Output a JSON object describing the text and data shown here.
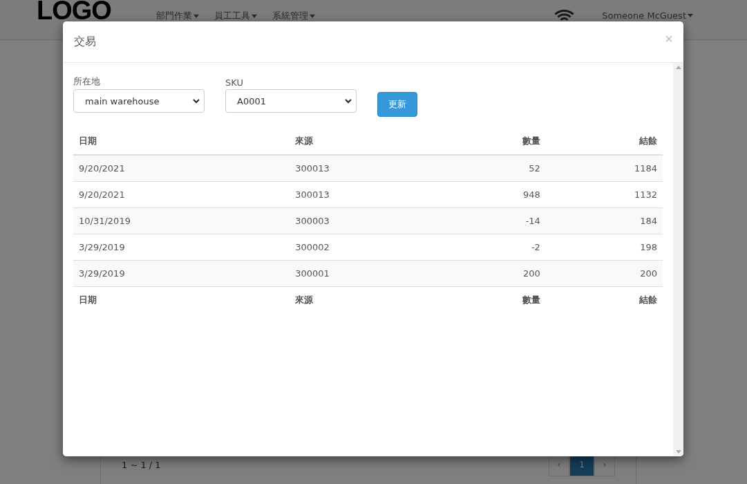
{
  "navbar": {
    "logo": "LOGO",
    "menus": [
      {
        "label": "部門作業"
      },
      {
        "label": "員工工具"
      },
      {
        "label": "系統管理"
      }
    ],
    "user": "Someone McGuest"
  },
  "background_page": {
    "pager_info": "1 ~ 1 / 1",
    "pagination": [
      {
        "label": "‹",
        "selected": false
      },
      {
        "label": "1",
        "selected": true
      },
      {
        "label": "›",
        "selected": false
      }
    ]
  },
  "modal": {
    "title": "交易",
    "close": "×",
    "filters": [
      {
        "label": "所在地",
        "value": "main warehouse"
      },
      {
        "label": "SKU",
        "value": "A0001"
      }
    ],
    "update_button": "更新",
    "table": {
      "columns": [
        {
          "label": "日期"
        },
        {
          "label": "來源"
        },
        {
          "label": "數量"
        },
        {
          "label": "結餘"
        }
      ],
      "rows": [
        [
          "9/20/2021",
          "300013",
          "52",
          "1184"
        ],
        [
          "9/20/2021",
          "300013",
          "948",
          "1132"
        ],
        [
          "10/31/2019",
          "300003",
          "-14",
          "184"
        ],
        [
          "3/29/2019",
          "300002",
          "-2",
          "198"
        ],
        [
          "3/29/2019",
          "300001",
          "200",
          "200"
        ]
      ],
      "footer": [
        "日期",
        "來源",
        "數量",
        "結餘"
      ]
    }
  }
}
